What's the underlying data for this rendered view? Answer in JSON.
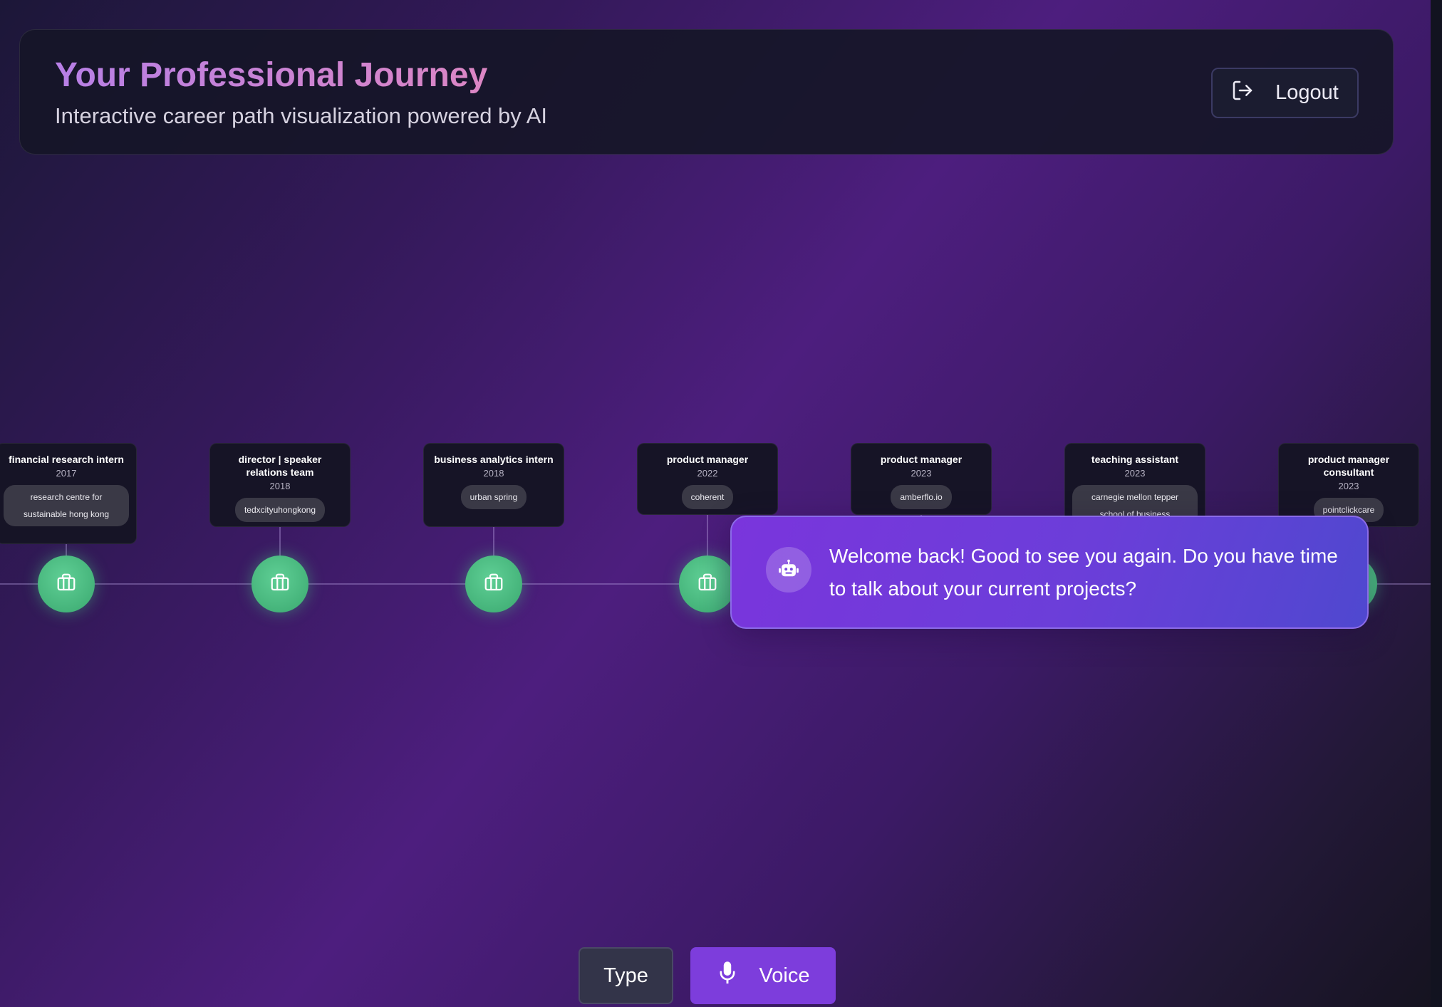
{
  "header": {
    "title": "Your Professional Journey",
    "subtitle": "Interactive career path visualization powered by AI",
    "logout_label": "Logout"
  },
  "timeline": {
    "entries": [
      {
        "title": "financial research intern",
        "year": "2017",
        "company": "research centre for sustainable hong kong"
      },
      {
        "title": "director | speaker relations team",
        "year": "2018",
        "company": "tedxcityuhongkong"
      },
      {
        "title": "business analytics intern",
        "year": "2018",
        "company": "urban spring"
      },
      {
        "title": "product manager",
        "year": "2022",
        "company": "coherent"
      },
      {
        "title": "product manager",
        "year": "2023",
        "company": "amberflo.io"
      },
      {
        "title": "teaching assistant",
        "year": "2023",
        "company": "carnegie mellon tepper school of business"
      },
      {
        "title": "product manager consultant",
        "year": "2023",
        "company": "pointclickcare"
      }
    ],
    "node_icon": "briefcase-icon"
  },
  "assistant": {
    "icon": "robot-icon",
    "message": "Welcome back! Good to see you again. Do you have time to talk about your current projects?"
  },
  "input_mode": {
    "type_label": "Type",
    "voice_label": "Voice",
    "voice_icon": "microphone-icon"
  },
  "colors": {
    "accent": "#7d3ddc",
    "node": "#4fbf85",
    "title_gradient_start": "#b77fe6",
    "title_gradient_end": "#dc86c4"
  }
}
